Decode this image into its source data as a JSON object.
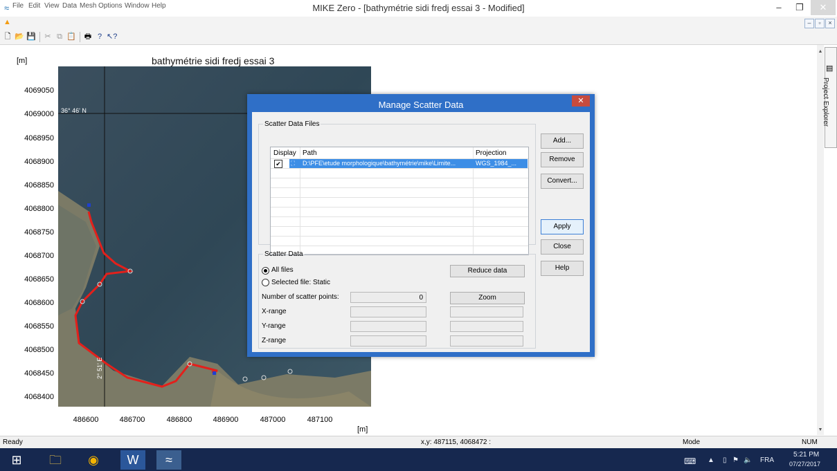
{
  "window": {
    "title": "MIKE Zero - [bathymétrie sidi fredj essai 3 - Modified]",
    "minimize": "–",
    "restore": "❐",
    "close": "✕"
  },
  "menu": {
    "items": [
      "File",
      "Edit",
      "View",
      "Data",
      "Mesh",
      "Options",
      "Window",
      "Help"
    ]
  },
  "toolbar": {
    "icons": [
      "new-icon",
      "open-icon",
      "save-icon",
      "cut-icon",
      "copy-icon",
      "paste-icon",
      "print-icon",
      "help-icon",
      "context-help-icon"
    ]
  },
  "plot": {
    "title": "bathymétrie sidi fredj essai 3",
    "y_unit": "[m]",
    "x_unit": "[m]",
    "y_ticks": [
      "4069050",
      "4069000",
      "4068950",
      "4068900",
      "4068850",
      "4068800",
      "4068750",
      "4068700",
      "4068650",
      "4068600",
      "4068550",
      "4068500",
      "4068450",
      "4068400"
    ],
    "x_ticks": [
      "486600",
      "486700",
      "486800",
      "486900",
      "487000",
      "487100"
    ],
    "lat_label": "36° 46' N",
    "lon_label": "2° 51' E",
    "boundary_color": "#e3201b"
  },
  "explorer": {
    "label": "Project Explorer"
  },
  "dialog": {
    "title": "Manage Scatter Data",
    "close": "✕",
    "files_group": "Scatter Data Files",
    "columns": [
      "Display",
      "Path",
      "Projection"
    ],
    "rows": [
      {
        "checked": true,
        "path": "D:\\PFE\\etude morphologique\\bathymétrie\\mike\\Limite...",
        "projection": "WGS_1984_..."
      }
    ],
    "buttons": {
      "add": "Add...",
      "remove": "Remove",
      "convert": "Convert...",
      "apply": "Apply",
      "close": "Close",
      "help": "Help"
    },
    "scatter_group": "Scatter Data",
    "radio_all": "All files",
    "radio_selected": "Selected file:",
    "selected_value": "Static",
    "reduce": "Reduce data",
    "zoom": "Zoom",
    "num_points_label": "Number of scatter points:",
    "num_points": "0",
    "x_range": "X-range",
    "y_range": "Y-range",
    "z_range": "Z-range"
  },
  "status": {
    "ready": "Ready",
    "coords": "x,y: 487115, 4068472 :",
    "mode": "Mode",
    "num": "NUM"
  },
  "taskbar": {
    "apps": [
      "windows-start-icon",
      "file-explorer-icon",
      "chrome-icon",
      "word-icon",
      "mike-zero-icon"
    ],
    "lang": "FRA",
    "time": "5:21 PM",
    "date": "07/27/2017"
  }
}
